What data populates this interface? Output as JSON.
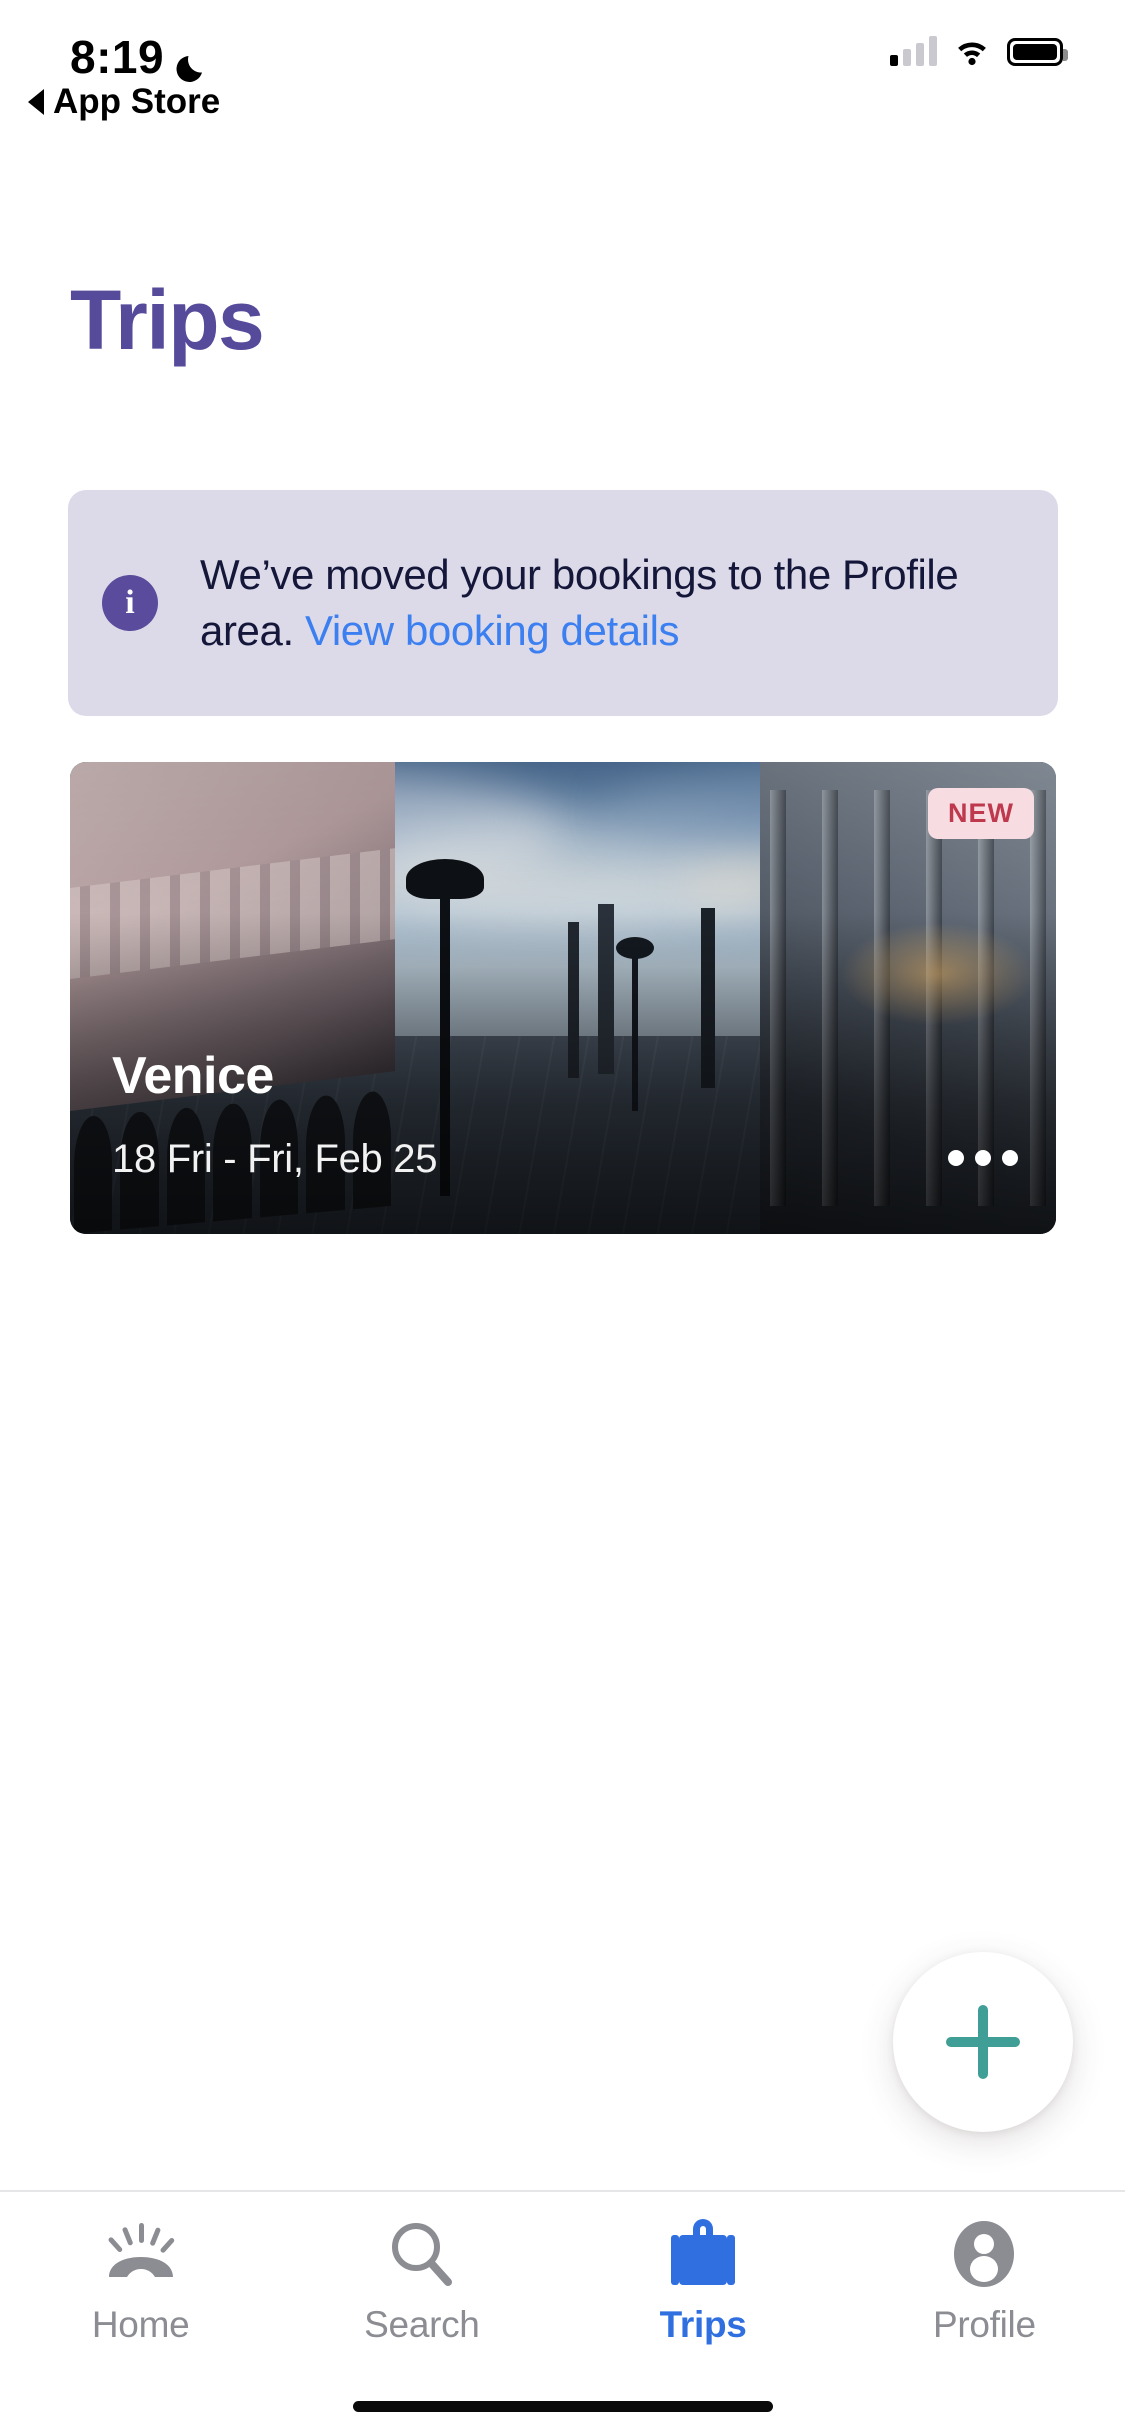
{
  "statusbar": {
    "time": "8:19",
    "dnd_icon": "crescent-moon-icon",
    "back_label": "App Store",
    "signal_icon": "cellular-signal-icon",
    "wifi_icon": "wifi-icon",
    "battery_icon": "battery-icon",
    "signal_bars_filled": 1,
    "signal_bars_total": 4,
    "battery_level_pct": 92
  },
  "header": {
    "title": "Trips",
    "title_color": "#564a9b"
  },
  "banner": {
    "icon": "info-icon",
    "icon_glyph": "i",
    "text_before_link": "We’ve moved your bookings to the Profile area. ",
    "link_label": "View booking details",
    "background_color": "#dcdae8",
    "text_color": "#14173a",
    "link_color": "#3b7ff0",
    "icon_color": "#5b4b9c"
  },
  "trip_card": {
    "badge": "NEW",
    "badge_bg": "#f7dde2",
    "badge_color": "#bf394e",
    "destination": "Venice",
    "dates": "18 Fri - Fri, Feb 25",
    "overflow_icon": "more-options-icon",
    "photo_alt": "Venice Piazza San Marco at dusk"
  },
  "fab": {
    "icon": "plus-icon",
    "icon_color": "#3f9e95",
    "background": "#ffffff"
  },
  "tabbar": {
    "active_color": "#2f6fe0",
    "inactive_color": "#8b8d93",
    "items": [
      {
        "label": "Home",
        "icon": "sunrise-icon",
        "active": false
      },
      {
        "label": "Search",
        "icon": "search-icon",
        "active": false
      },
      {
        "label": "Trips",
        "icon": "suitcase-icon",
        "active": true
      },
      {
        "label": "Profile",
        "icon": "person-icon",
        "active": false
      }
    ]
  }
}
